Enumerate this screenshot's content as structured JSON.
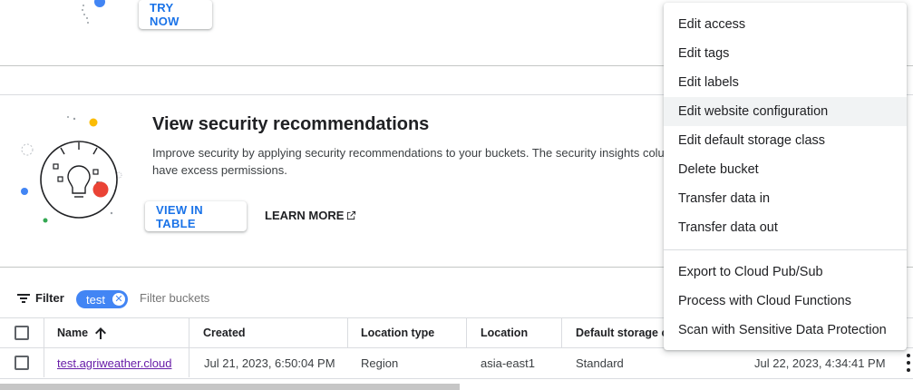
{
  "top_card": {
    "try_now_label": "TRY NOW"
  },
  "security_card": {
    "title": "View security recommendations",
    "description_line1": "Improve security by applying security recommendations to your buckets. The security insights colu",
    "description_line2": "have excess permissions.",
    "view_in_table_label": "VIEW IN TABLE",
    "learn_more_label": "LEARN MORE"
  },
  "filter_bar": {
    "filter_label": "Filter",
    "chip_label": "test",
    "placeholder": "Filter buckets"
  },
  "table": {
    "columns": {
      "name": "Name",
      "created": "Created",
      "location_type": "Location type",
      "location": "Location",
      "storage_class": "Default storage cla"
    },
    "rows": [
      {
        "name": "test.agriweather.cloud",
        "created": "Jul 21, 2023, 6:50:04 PM",
        "location_type": "Region",
        "location": "asia-east1",
        "storage_class": "Standard",
        "last_modified": "Jul 22, 2023, 4:34:41 PM"
      }
    ]
  },
  "menu": {
    "group1": [
      "Edit access",
      "Edit tags",
      "Edit labels",
      "Edit website configuration",
      "Edit default storage class",
      "Delete bucket",
      "Transfer data in",
      "Transfer data out"
    ],
    "group2": [
      "Export to Cloud Pub/Sub",
      "Process with Cloud Functions",
      "Scan with Sensitive Data Protection"
    ],
    "highlighted_item": "Edit website configuration"
  },
  "colors": {
    "accent": "#1a73e8",
    "chip": "#4285f4",
    "link_visited": "#681da8"
  }
}
